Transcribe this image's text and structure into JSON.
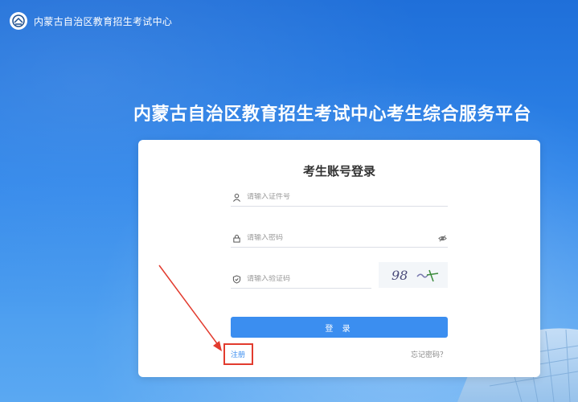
{
  "header": {
    "org_name": "内蒙古自治区教育招生考试中心",
    "logo_icon": "org-logo-icon"
  },
  "platform_title": "内蒙古自治区教育招生考试中心考生综合服务平台",
  "login": {
    "title": "考生账号登录",
    "id_placeholder": "请输入证件号",
    "password_placeholder": "请输入密码",
    "captcha_placeholder": "请输入验证码",
    "captcha_text": "98",
    "submit_label": "登 录",
    "register_label": "注册",
    "forgot_label": "忘记密码？"
  },
  "colors": {
    "primary": "#3b8ef0",
    "annotation": "#e23b2e"
  }
}
